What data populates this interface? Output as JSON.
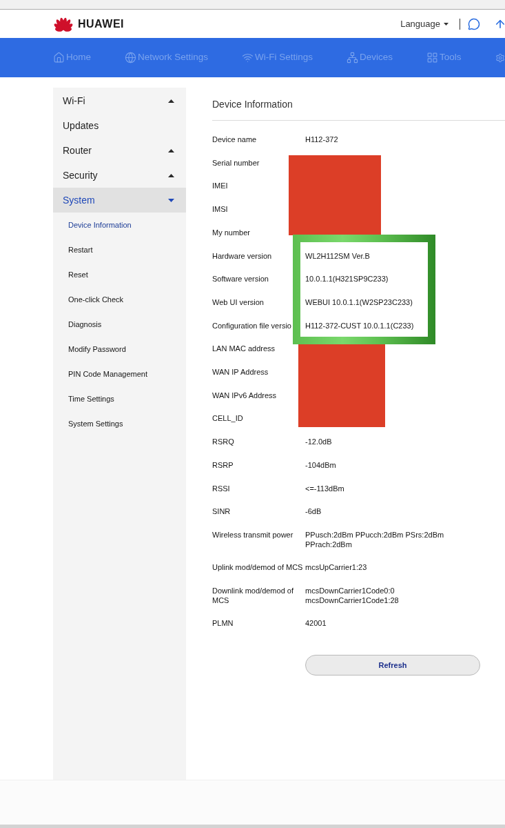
{
  "header": {
    "logo_text": "HUAWEI",
    "language": "Language"
  },
  "nav": [
    {
      "label": "Home",
      "selected": false
    },
    {
      "label": "Network Settings",
      "selected": false
    },
    {
      "label": "Wi-Fi Settings",
      "selected": false
    },
    {
      "label": "Devices",
      "selected": false
    },
    {
      "label": "Tools",
      "selected": false
    }
  ],
  "sidebar": {
    "items": [
      {
        "label": "Wi-Fi",
        "kind": "group",
        "expanded": false,
        "selected": false
      },
      {
        "label": "Updates",
        "kind": "page",
        "selected": false
      },
      {
        "label": "Router",
        "kind": "group",
        "expanded": false,
        "selected": false
      },
      {
        "label": "Security",
        "kind": "group",
        "expanded": false,
        "selected": false
      },
      {
        "label": "System",
        "kind": "group",
        "expanded": true,
        "selected": true,
        "children": [
          {
            "label": "Device Information",
            "selected": true
          },
          {
            "label": "Restart",
            "selected": false
          },
          {
            "label": "Reset",
            "selected": false
          },
          {
            "label": "One-click Check",
            "selected": false
          },
          {
            "label": "Diagnosis",
            "selected": false
          },
          {
            "label": "Modify Password",
            "selected": false
          },
          {
            "label": "PIN Code Management",
            "selected": false
          },
          {
            "label": "Time Settings",
            "selected": false
          },
          {
            "label": "System Settings",
            "selected": false
          }
        ]
      }
    ]
  },
  "content": {
    "title": "Device Information",
    "rows": [
      {
        "label": "Device name",
        "value": "H112-372",
        "redacted": false,
        "highlighted": false
      },
      {
        "label": "Serial number",
        "redacted": true,
        "highlighted": false
      },
      {
        "label": "IMEI",
        "redacted": true,
        "highlighted": false
      },
      {
        "label": "IMSI",
        "redacted": true,
        "highlighted": false
      },
      {
        "label": "My number",
        "redacted": true,
        "highlighted": false
      },
      {
        "label": "Hardware version",
        "value": "WL2H112SM Ver.B",
        "redacted": false,
        "highlighted": true
      },
      {
        "label": "Software version",
        "value": "10.0.1.1(H321SP9C233)",
        "redacted": false,
        "highlighted": true
      },
      {
        "label": "Web UI version",
        "value": "WEBUI 10.0.1.1(W2SP23C233)",
        "redacted": false,
        "highlighted": true
      },
      {
        "label": "Configuration file versio",
        "value": "H112-372-CUST 10.0.1.1(C233)",
        "redacted": false,
        "highlighted": true
      },
      {
        "label": "LAN MAC address",
        "redacted": true,
        "highlighted": false
      },
      {
        "label": "WAN IP Address",
        "redacted": true,
        "highlighted": false
      },
      {
        "label": "WAN IPv6 Address",
        "redacted": true,
        "highlighted": false
      },
      {
        "label": "CELL_ID",
        "redacted": true,
        "highlighted": false
      },
      {
        "label": "RSRQ",
        "value": "-12.0dB",
        "redacted": false,
        "highlighted": false
      },
      {
        "label": "RSRP",
        "value": "-104dBm",
        "redacted": false,
        "highlighted": false
      },
      {
        "label": "RSSI",
        "value": "<=-113dBm",
        "redacted": false,
        "highlighted": false
      },
      {
        "label": "SINR",
        "value": "-6dB",
        "redacted": false,
        "highlighted": false
      },
      {
        "label": "Wireless transmit power",
        "value": "PPusch:2dBm PPucch:2dBm PSrs:2dBm PPrach:2dBm",
        "redacted": false,
        "highlighted": false
      },
      {
        "label": "Uplink mod/demod of MCS",
        "value": "mcsUpCarrier1:23",
        "redacted": false,
        "highlighted": false
      },
      {
        "label": "Downlink mod/demod of MCS",
        "value": "mcsDownCarrier1Code0:0 mcsDownCarrier1Code1:28",
        "redacted": false,
        "highlighted": false
      },
      {
        "label": "PLMN",
        "value": "42001",
        "redacted": false,
        "highlighted": false
      }
    ],
    "refresh_button": "Refresh"
  }
}
